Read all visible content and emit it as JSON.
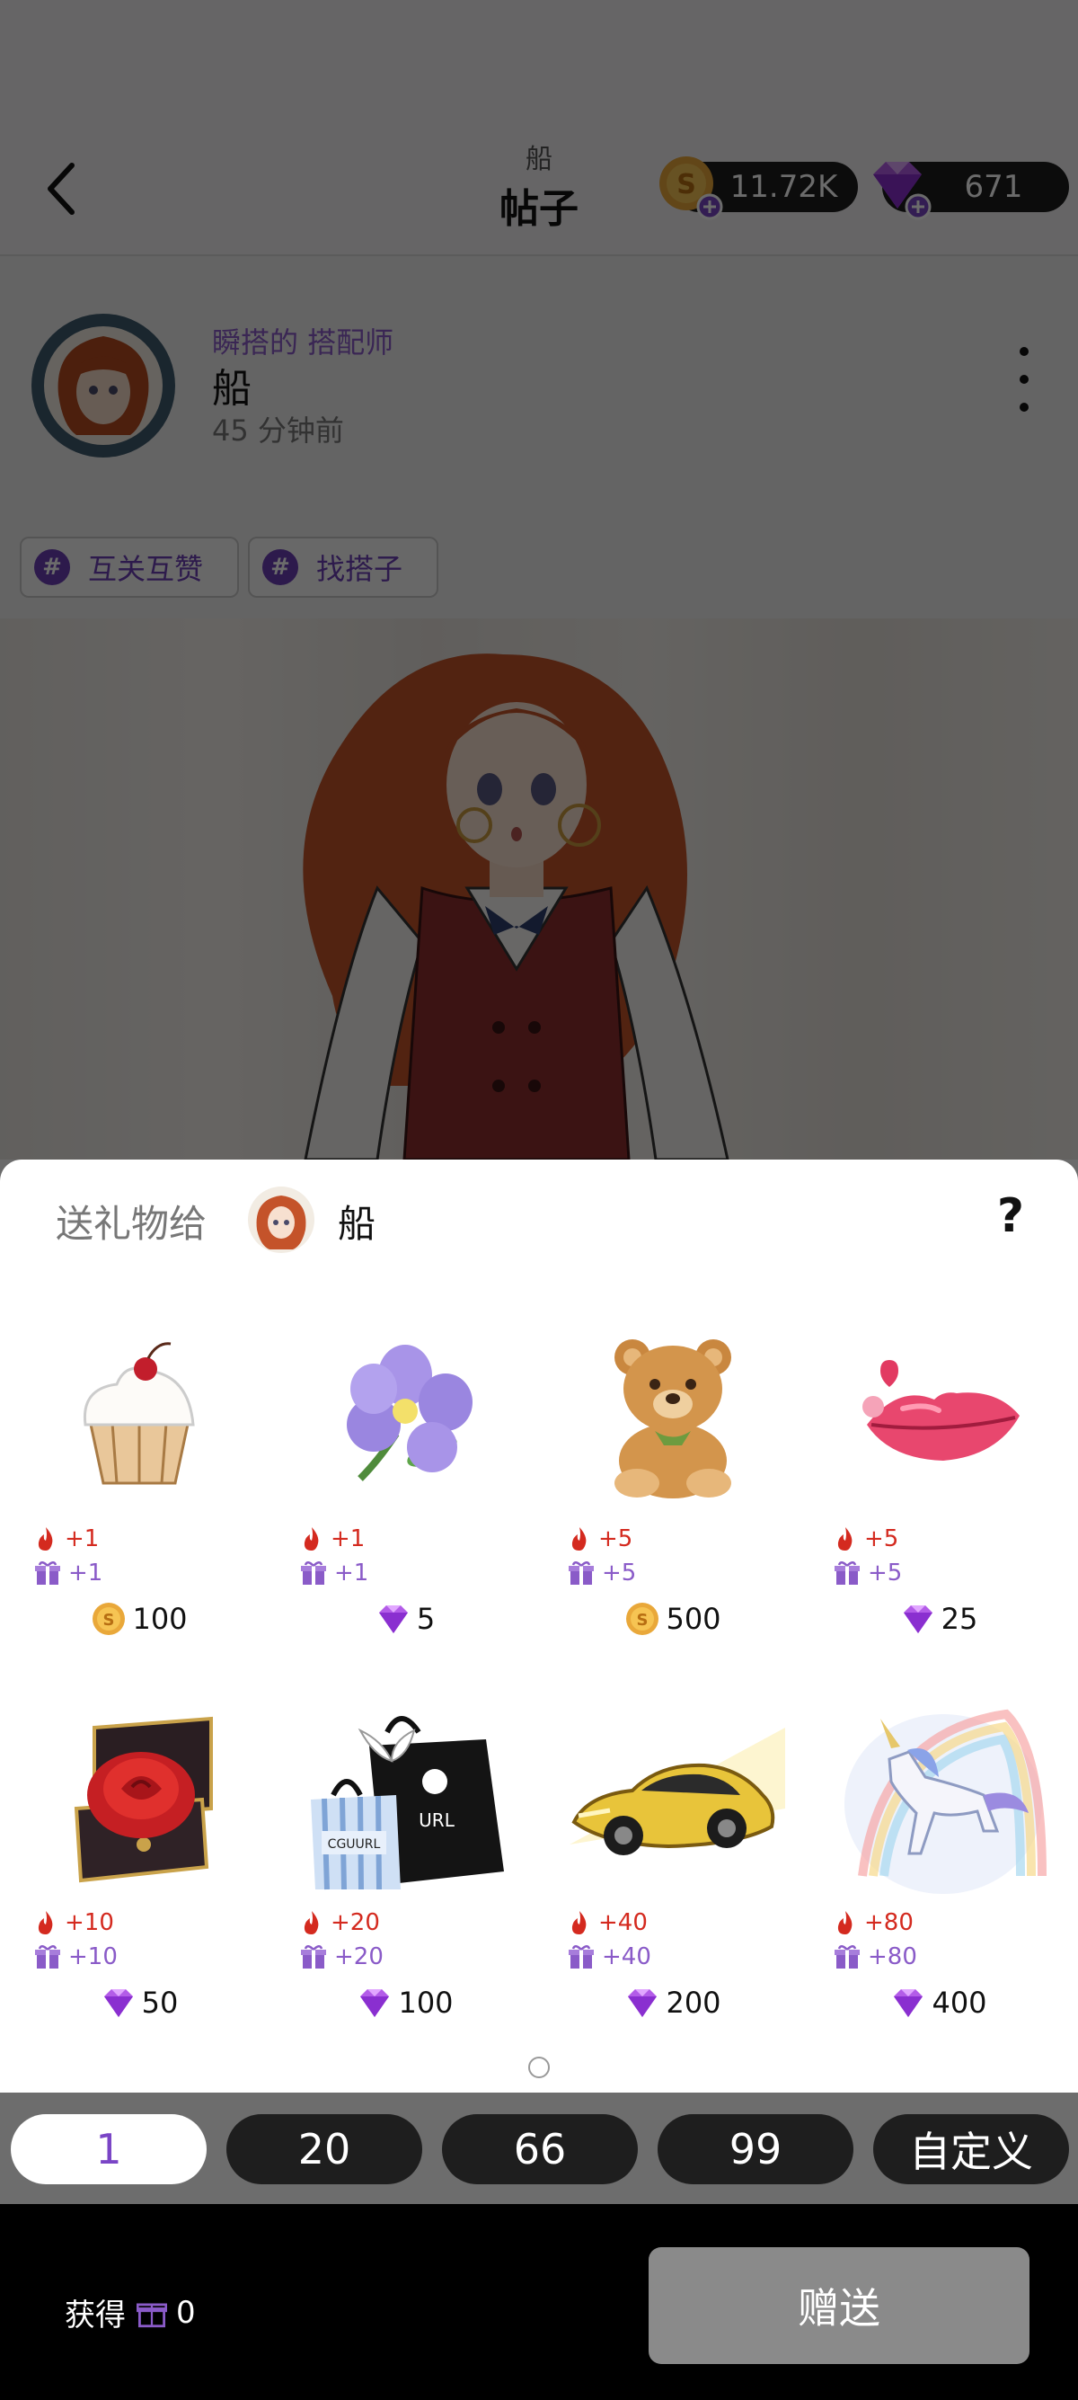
{
  "header": {
    "subtitle": "船",
    "title": "帖子",
    "coins": "11.72K",
    "gems": "671"
  },
  "author": {
    "role": "瞬搭的 搭配师",
    "name": "船",
    "time": "45 分钟前"
  },
  "tags": [
    {
      "symbol": "#",
      "label": "互关互赞"
    },
    {
      "symbol": "#",
      "label": "找搭子"
    }
  ],
  "sheet": {
    "title": "送礼物给",
    "recipient": "船",
    "help": "?"
  },
  "gifts": [
    {
      "name": "cupcake",
      "heat": "+1",
      "points": "+1",
      "currency": "coin",
      "price": "100"
    },
    {
      "name": "flower",
      "heat": "+1",
      "points": "+1",
      "currency": "gem",
      "price": "5"
    },
    {
      "name": "teddy-bear",
      "heat": "+5",
      "points": "+5",
      "currency": "coin",
      "price": "500"
    },
    {
      "name": "kiss-lips",
      "heat": "+5",
      "points": "+5",
      "currency": "gem",
      "price": "25"
    },
    {
      "name": "rose-box",
      "heat": "+10",
      "points": "+10",
      "currency": "gem",
      "price": "50"
    },
    {
      "name": "shopping-bags",
      "heat": "+20",
      "points": "+20",
      "currency": "gem",
      "price": "100"
    },
    {
      "name": "sports-car",
      "heat": "+40",
      "points": "+40",
      "currency": "gem",
      "price": "200"
    },
    {
      "name": "unicorn",
      "heat": "+80",
      "points": "+80",
      "currency": "gem",
      "price": "400"
    }
  ],
  "bag_labels": {
    "left": "CGUURL",
    "right": "URL"
  },
  "quantities": [
    "1",
    "20",
    "66",
    "99",
    "自定义"
  ],
  "selected_quantity": "1",
  "footer": {
    "earn_label": "获得",
    "earn_value": "0",
    "send_label": "赠送"
  },
  "colors": {
    "accent_purple": "#7a45c6",
    "heat_red": "#d42a1f",
    "points_purple": "#8a5bc8",
    "send_disabled": "#8a8a8a"
  }
}
